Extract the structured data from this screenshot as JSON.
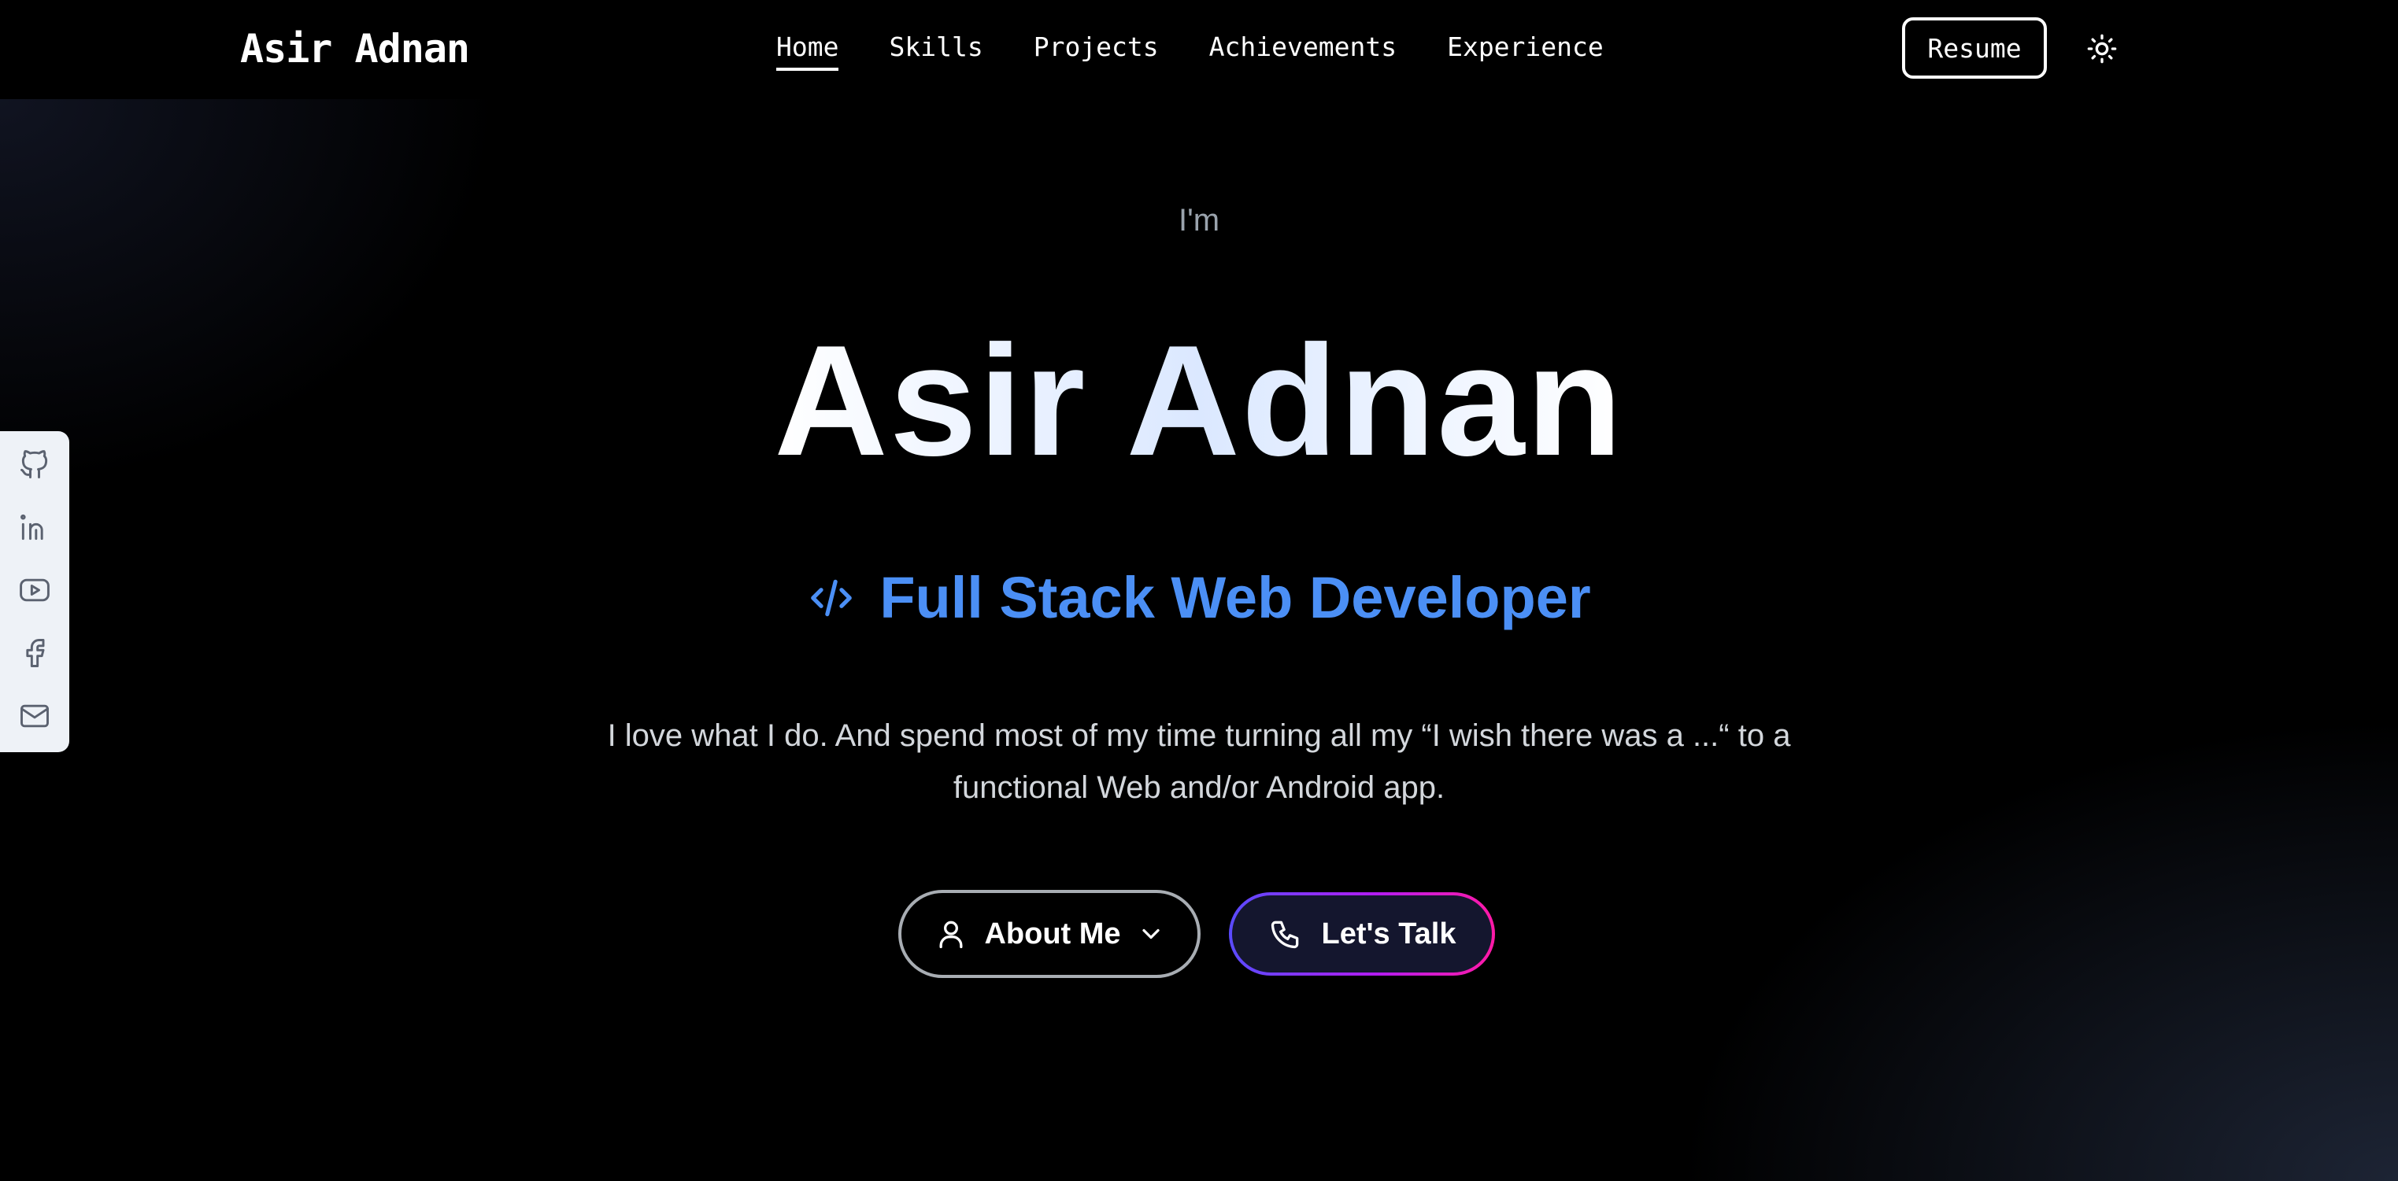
{
  "header": {
    "brand": "Asir Adnan",
    "nav": [
      {
        "label": "Home",
        "active": true
      },
      {
        "label": "Skills",
        "active": false
      },
      {
        "label": "Projects",
        "active": false
      },
      {
        "label": "Achievements",
        "active": false
      },
      {
        "label": "Experience",
        "active": false
      }
    ],
    "resume_label": "Resume",
    "theme_icon": "sun-icon"
  },
  "social": [
    {
      "icon": "github-icon"
    },
    {
      "icon": "linkedin-icon"
    },
    {
      "icon": "youtube-icon"
    },
    {
      "icon": "facebook-icon"
    },
    {
      "icon": "mail-icon"
    }
  ],
  "hero": {
    "greeting": "I'm",
    "name": "Asir Adnan",
    "role_icon": "code-icon",
    "role": "Full Stack Web Developer",
    "bio": "I love what I do. And spend most of my time turning all my “I wish there was a ...“ to a functional Web and/or Android app.",
    "about_label": "About Me",
    "talk_label": "Let's Talk"
  },
  "colors": {
    "accent_blue": "#4b8ff5",
    "gradient_start": "#5a4bff",
    "gradient_end": "#ff1aa6"
  }
}
